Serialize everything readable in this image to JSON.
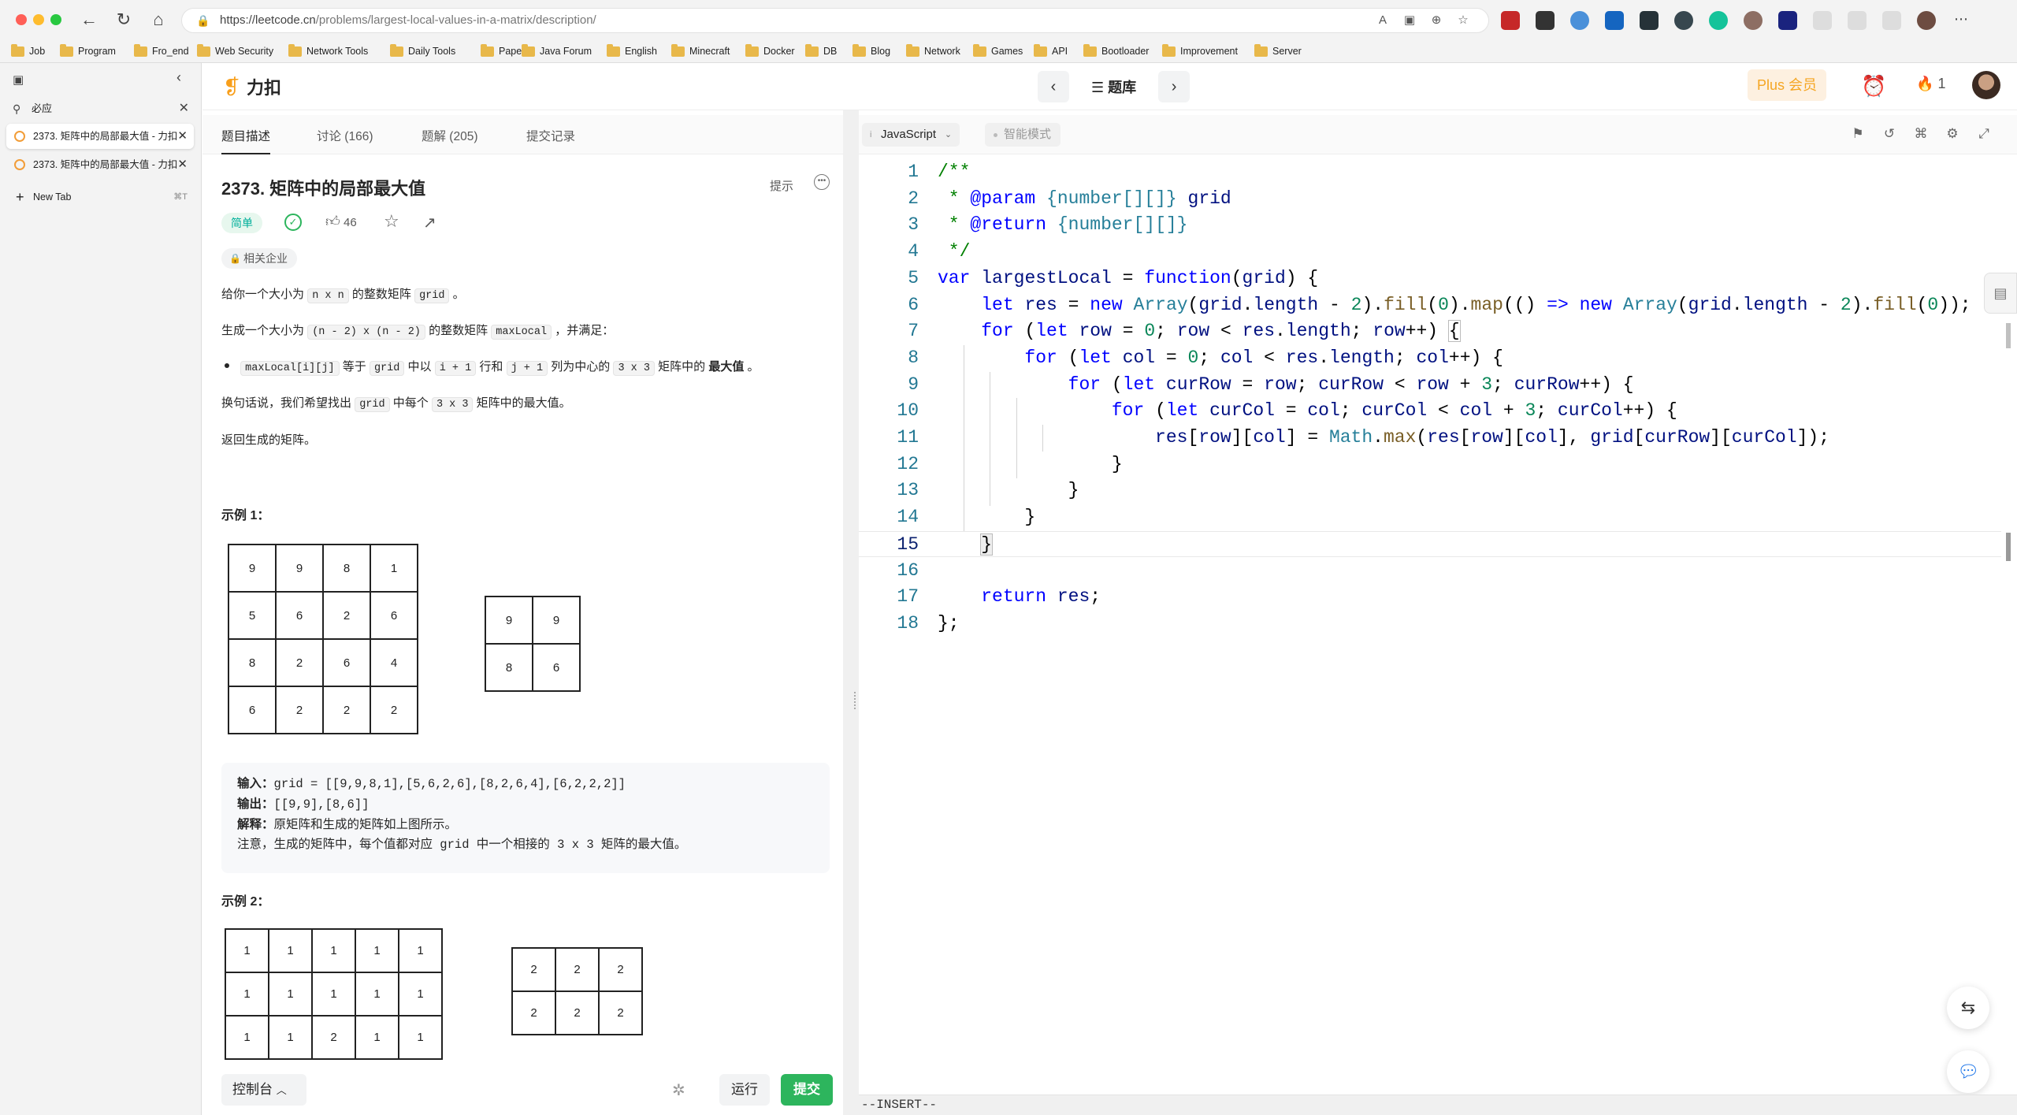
{
  "browser": {
    "url_host": "https://leetcode.cn",
    "url_path": "/problems/largest-local-values-in-a-matrix/description/",
    "bookmarks": [
      "Job",
      "Program",
      "Fro_end",
      "Web Security",
      "Network Tools",
      "Daily Tools",
      "Paper",
      "Java Forum",
      "English",
      "Minecraft",
      "Docker",
      "DB",
      "Blog",
      "Network",
      "Games",
      "API",
      "Bootloader",
      "Improvement",
      "Server"
    ]
  },
  "sidebar": {
    "search_value": "必应",
    "tabs": [
      {
        "label": "2373. 矩阵中的局部最大值 - 力扣"
      },
      {
        "label": "2373. 矩阵中的局部最大值 - 力扣"
      }
    ],
    "new_tab_label": "New Tab",
    "new_tab_shortcut": "⌘T"
  },
  "header": {
    "logo_text": "力扣",
    "bank_label": "题库",
    "plus_label": "Plus 会员",
    "streak_count": "1"
  },
  "left": {
    "tabs": [
      "题目描述",
      "讨论 (166)",
      "题解 (205)",
      "提交记录"
    ],
    "title": "2373. 矩阵中的局部最大值",
    "hint": "提示",
    "difficulty": "简单",
    "likes": "46",
    "company_tag": "相关企业",
    "p1_a": "给你一个大小为",
    "p1_code1": "n x n",
    "p1_b": "的整数矩阵",
    "p1_code2": "grid",
    "p1_c": "。",
    "p2_a": "生成一个大小为",
    "p2_code1": "(n - 2) x (n - 2)",
    "p2_b": "的整数矩阵",
    "p2_code2": "maxLocal",
    "p2_c": "，并满足：",
    "li_code1": "maxLocal[i][j]",
    "li_a": "等于",
    "li_code2": "grid",
    "li_b": "中以",
    "li_code3": "i + 1",
    "li_c": "行和",
    "li_code4": "j + 1",
    "li_d": "列为中心的",
    "li_code5": "3 x 3",
    "li_e": "矩阵中的",
    "li_bold": "最大值",
    "li_f": "。",
    "p3_a": "换句话说，我们希望找出",
    "p3_code1": "grid",
    "p3_b": "中每个",
    "p3_code2": "3 x 3",
    "p3_c": "矩阵中的最大值。",
    "p4": "返回生成的矩阵。",
    "ex1_title": "示例 1：",
    "ex1_grid": [
      [
        "9",
        "9",
        "8",
        "1"
      ],
      [
        "5",
        "6",
        "2",
        "6"
      ],
      [
        "8",
        "2",
        "6",
        "4"
      ],
      [
        "6",
        "2",
        "2",
        "2"
      ]
    ],
    "ex1_result": [
      [
        "9",
        "9"
      ],
      [
        "8",
        "6"
      ]
    ],
    "ex1_input_label": "输入：",
    "ex1_input": "grid = [[9,9,8,1],[5,6,2,6],[8,2,6,4],[6,2,2,2]]",
    "ex1_output_label": "输出：",
    "ex1_output": "[[9,9],[8,6]]",
    "ex1_explain_label": "解释：",
    "ex1_explain": "原矩阵和生成的矩阵如上图所示。",
    "ex1_note": "注意，生成的矩阵中，每个值都对应 grid 中一个相接的 3 x 3 矩阵的最大值。",
    "ex2_title": "示例 2：",
    "ex2_grid": [
      [
        "1",
        "1",
        "1",
        "1",
        "1"
      ],
      [
        "1",
        "1",
        "1",
        "1",
        "1"
      ],
      [
        "1",
        "1",
        "2",
        "1",
        "1"
      ]
    ],
    "ex2_result": [
      [
        "2",
        "2",
        "2"
      ],
      [
        "2",
        "2",
        "2"
      ]
    ],
    "console_label": "控制台",
    "run_label": "运行",
    "submit_label": "提交"
  },
  "editor": {
    "language": "JavaScript",
    "smart_mode": "智能模式",
    "line_numbers": [
      "1",
      "2",
      "3",
      "4",
      "5",
      "6",
      "7",
      "8",
      "9",
      "10",
      "11",
      "12",
      "13",
      "14",
      "15",
      "16",
      "17",
      "18"
    ],
    "current_line": 15,
    "status": "--INSERT--"
  },
  "colors": {
    "accent_green": "#2db55d",
    "plus_orange": "#f5a623",
    "keyword_blue": "#0000ff",
    "comment_green": "#008000"
  }
}
